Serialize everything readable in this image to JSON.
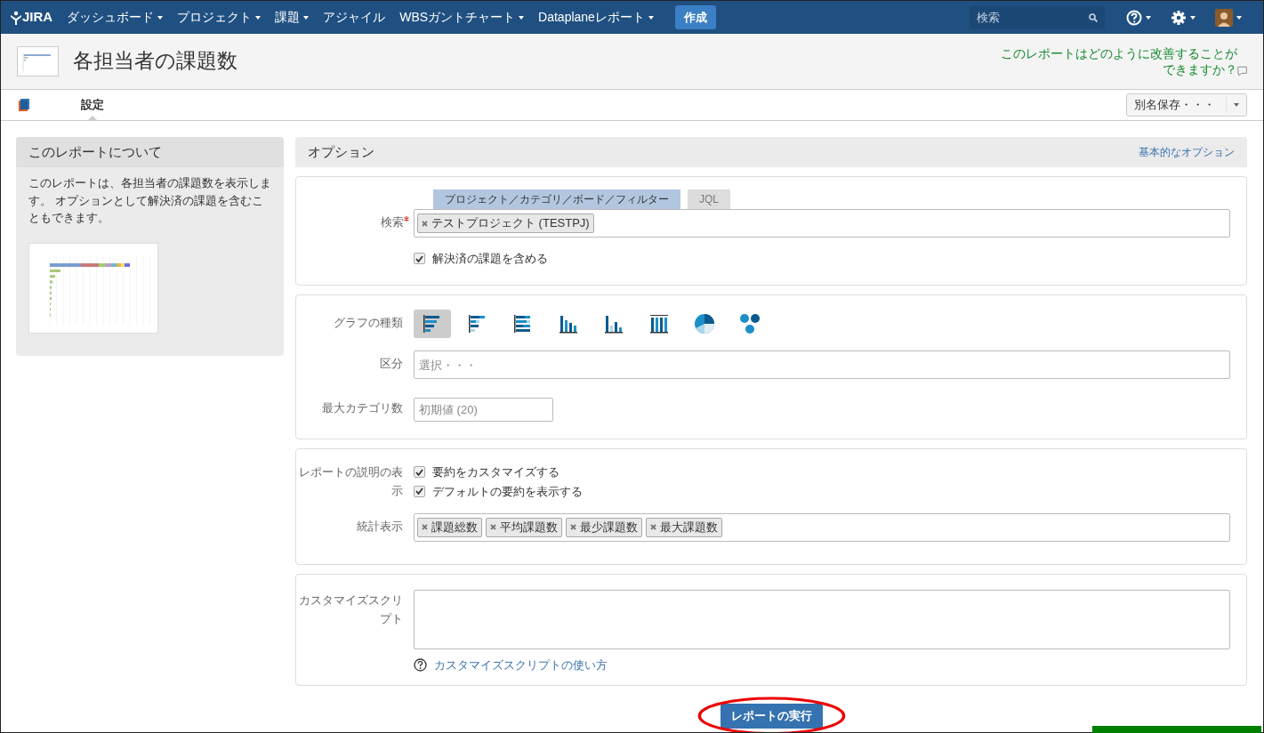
{
  "nav": {
    "logo": "JIRA",
    "menus": [
      {
        "label": "ダッシュボード",
        "dropdown": true
      },
      {
        "label": "プロジェクト",
        "dropdown": true
      },
      {
        "label": "課題",
        "dropdown": true
      },
      {
        "label": "アジャイル",
        "dropdown": false
      },
      {
        "label": "WBSガントチャート",
        "dropdown": true
      },
      {
        "label": "Dataplaneレポート",
        "dropdown": true
      }
    ],
    "create_button": "作成",
    "search": {
      "placeholder": "検索"
    }
  },
  "header": {
    "title": "各担当者の課題数",
    "feedback_link": "このレポートはどのように改善することができますか？"
  },
  "tabs": [
    {
      "label": "設定",
      "selected": true
    }
  ],
  "save_button": "別名保存・・・",
  "about": {
    "title": "このレポートについて",
    "description": "このレポートは、各担当者の課題数を表示します。 オプションとして解決済の課題を含むこともできます。"
  },
  "options": {
    "title": "オプション",
    "basic_link": "基本的なオプション",
    "search": {
      "label": "検索",
      "required": true,
      "modes": [
        {
          "label": "プロジェクト／カテゴリ／ボード／フィルター",
          "selected": true
        },
        {
          "label": "JQL",
          "selected": false
        }
      ],
      "tokens": [
        "テストプロジェクト (TESTPJ)"
      ],
      "include_resolved": {
        "label": "解決済の課題を含める",
        "checked": true
      }
    },
    "chart_type": {
      "label": "グラフの種類",
      "types": [
        {
          "kind": "hbar",
          "selected": true
        },
        {
          "kind": "hbar-stacked",
          "selected": false
        },
        {
          "kind": "hbar-full",
          "selected": false
        },
        {
          "kind": "column",
          "selected": false
        },
        {
          "kind": "column-stacked",
          "selected": false
        },
        {
          "kind": "column-full",
          "selected": false
        },
        {
          "kind": "pie",
          "selected": false
        },
        {
          "kind": "clusters",
          "selected": false
        }
      ]
    },
    "category": {
      "label": "区分",
      "placeholder": "選択・・・"
    },
    "max_categories": {
      "label": "最大カテゴリ数",
      "placeholder": "初期値 (20)"
    },
    "description_display": {
      "label": "レポートの説明の表示",
      "checkboxes": [
        {
          "label": "要約をカスタマイズする",
          "checked": true
        },
        {
          "label": "デフォルトの要約を表示する",
          "checked": true
        }
      ]
    },
    "stats": {
      "label": "統計表示",
      "tokens": [
        "課題総数",
        "平均課題数",
        "最少課題数",
        "最大課題数"
      ]
    },
    "script": {
      "label": "カスタマイズスクリプト",
      "help_link": "カスタマイズスクリプトの使い方"
    }
  },
  "run_button": "レポートの実行"
}
